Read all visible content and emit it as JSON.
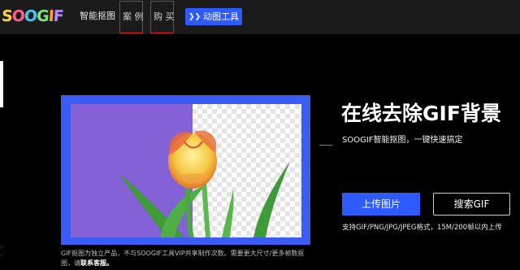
{
  "header": {
    "logo_text": "SOOGIF",
    "nav": {
      "smart_cutout": "智能抠图",
      "cases": "案 例",
      "buy": "购 买",
      "gif_tools": "动图工具"
    }
  },
  "hero": {
    "title": "在线去除GIF背景",
    "subtitle": "SOOGIF智能抠图，一键快速搞定",
    "upload_button": "上传图片",
    "search_button": "搜索GIF",
    "support_text": "支持GIF/PNG/JPG/JPEG格式，15M/200帧以内上传"
  },
  "caption": {
    "text": "GIF抠图为独立产品，不与SOOGIF工具VIP共享制作次数。需要更大尺寸/更多帧数抠图，请",
    "contact_link": "联系客服。"
  },
  "colors": {
    "accent": "#2e5bff",
    "frame": "#3a5cf2",
    "purple_bg": "#8561d8",
    "nav_bg": "#1b1b1b"
  },
  "icons": {
    "gif_tools": "double-chevron-icon"
  }
}
